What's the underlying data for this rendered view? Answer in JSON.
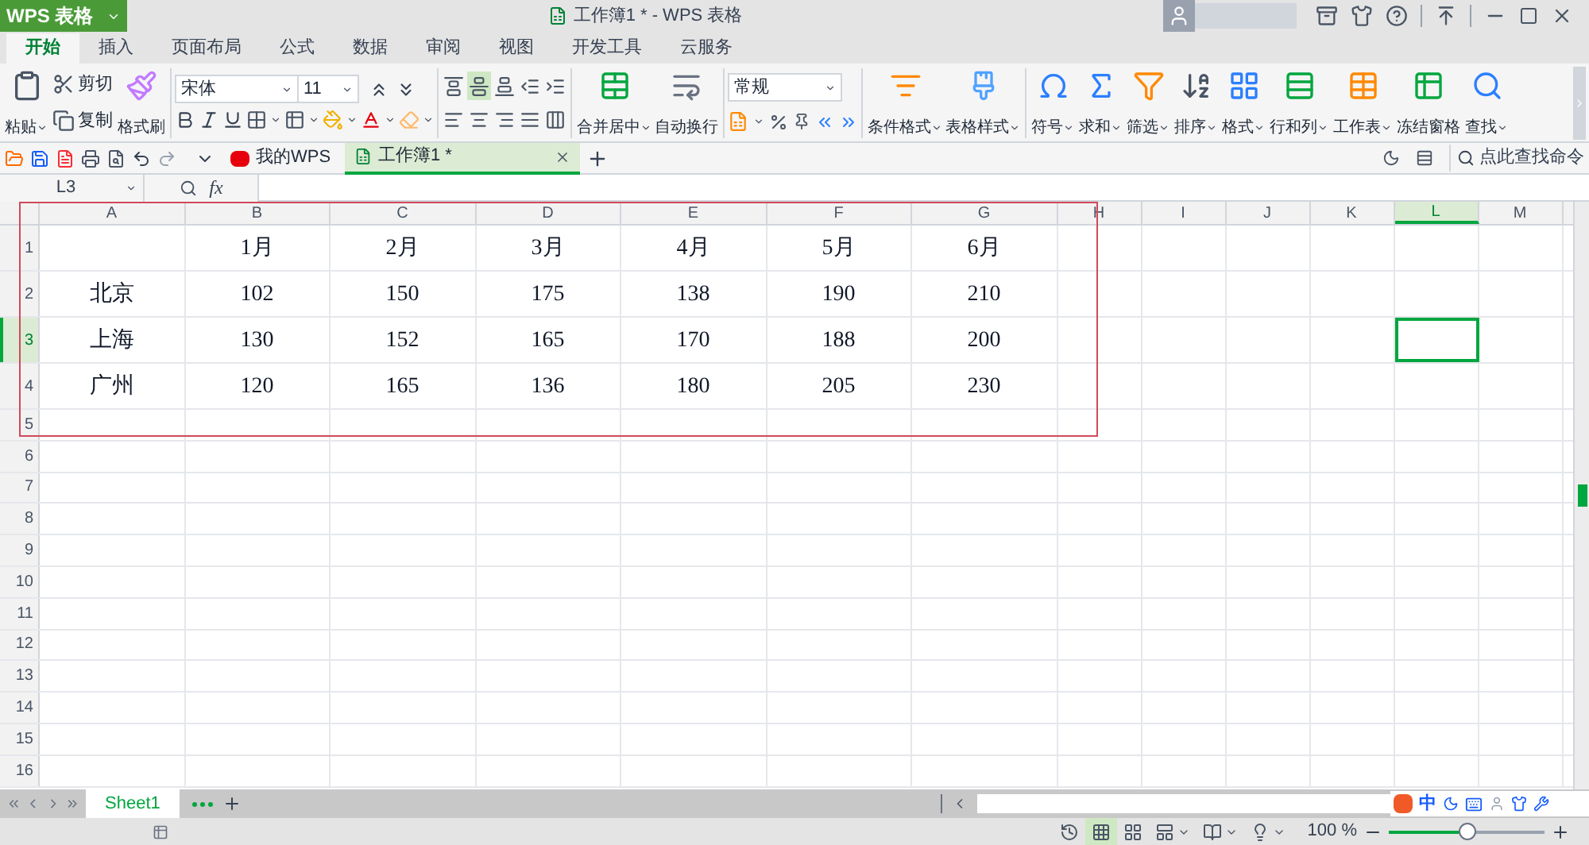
{
  "app_menu": {
    "label": "WPS 表格"
  },
  "window": {
    "title": "工作簿1 * - WPS 表格"
  },
  "ribbon_tabs": [
    {
      "label": "开始",
      "selected": true
    },
    {
      "label": "插入",
      "selected": false
    },
    {
      "label": "页面布局",
      "selected": false
    },
    {
      "label": "公式",
      "selected": false
    },
    {
      "label": "数据",
      "selected": false
    },
    {
      "label": "审阅",
      "selected": false
    },
    {
      "label": "视图",
      "selected": false
    },
    {
      "label": "开发工具",
      "selected": false
    },
    {
      "label": "云服务",
      "selected": false
    }
  ],
  "clipboard": {
    "paste": "粘贴",
    "cut": "剪切",
    "copy": "复制",
    "format_painter": "格式刷"
  },
  "font": {
    "name": "宋体",
    "size": "11"
  },
  "alignment": [
    {
      "kind": "top",
      "selected": false
    },
    {
      "kind": "middle",
      "selected": true
    },
    {
      "kind": "bottom",
      "selected": false
    },
    {
      "kind": "indent-less",
      "selected": false
    },
    {
      "kind": "indent-more",
      "selected": false
    },
    {
      "kind": "left",
      "selected": false
    },
    {
      "kind": "center",
      "selected": false
    },
    {
      "kind": "right",
      "selected": false
    },
    {
      "kind": "justify",
      "selected": false
    },
    {
      "kind": "distributed",
      "selected": false
    }
  ],
  "cell_buttons": [
    {
      "label": "合并居中",
      "menu": true
    },
    {
      "label": "自动换行",
      "menu": false
    }
  ],
  "number_format": "常规",
  "style_buttons": [
    {
      "label": "条件格式",
      "menu": true
    },
    {
      "label": "表格样式",
      "menu": true
    }
  ],
  "tool_buttons": [
    {
      "label": "符号",
      "menu": true
    },
    {
      "label": "求和",
      "menu": true
    },
    {
      "label": "筛选",
      "menu": true
    },
    {
      "label": "排序",
      "menu": true
    },
    {
      "label": "格式",
      "menu": true
    },
    {
      "label": "行和列",
      "menu": true
    },
    {
      "label": "工作表",
      "menu": true
    },
    {
      "label": "冻结窗格",
      "menu": false
    },
    {
      "label": "查找",
      "menu": true
    }
  ],
  "doc_tabs": [
    {
      "label": "我的WPS",
      "selected": false
    },
    {
      "label": "工作簿1 *",
      "selected": true
    }
  ],
  "command_search": {
    "placeholder": "点此查找命令"
  },
  "formula_bar": {
    "name_box": "L3",
    "function_label": "fx"
  },
  "columns": [
    {
      "label": "A",
      "selected": false
    },
    {
      "label": "B",
      "selected": false
    },
    {
      "label": "C",
      "selected": false
    },
    {
      "label": "D",
      "selected": false
    },
    {
      "label": "E",
      "selected": false
    },
    {
      "label": "F",
      "selected": false
    },
    {
      "label": "G",
      "selected": false
    },
    {
      "label": "H",
      "selected": false
    },
    {
      "label": "I",
      "selected": false
    },
    {
      "label": "J",
      "selected": false
    },
    {
      "label": "K",
      "selected": false
    },
    {
      "label": "L",
      "selected": true
    },
    {
      "label": "M",
      "selected": false
    }
  ],
  "rows": [
    {
      "label": "1",
      "selected": false,
      "cells": [
        "",
        "1月",
        "2月",
        "3月",
        "4月",
        "5月",
        "6月"
      ]
    },
    {
      "label": "2",
      "selected": false,
      "cells": [
        "北京",
        "102",
        "150",
        "175",
        "138",
        "190",
        "210"
      ]
    },
    {
      "label": "3",
      "selected": true,
      "cells": [
        "上海",
        "130",
        "152",
        "165",
        "170",
        "188",
        "200"
      ]
    },
    {
      "label": "4",
      "selected": false,
      "cells": [
        "广州",
        "120",
        "165",
        "136",
        "180",
        "205",
        "230"
      ]
    },
    {
      "label": "5",
      "selected": false
    },
    {
      "label": "6",
      "selected": false
    },
    {
      "label": "7",
      "selected": false
    },
    {
      "label": "8",
      "selected": false
    },
    {
      "label": "9",
      "selected": false
    },
    {
      "label": "10",
      "selected": false
    },
    {
      "label": "11",
      "selected": false
    },
    {
      "label": "12",
      "selected": false
    },
    {
      "label": "13",
      "selected": false
    },
    {
      "label": "14",
      "selected": false
    },
    {
      "label": "15",
      "selected": false
    },
    {
      "label": "16",
      "selected": false
    }
  ],
  "sheet_tabs": [
    {
      "label": "Sheet1",
      "selected": true
    }
  ],
  "ime_toolbar": {
    "mode": "中"
  },
  "status_bar": {
    "views": [
      {
        "kind": "normal",
        "selected": true
      },
      {
        "kind": "page-break",
        "selected": false
      },
      {
        "kind": "page-layout",
        "selected": false
      },
      {
        "kind": "reading",
        "selected": false
      },
      {
        "kind": "eye-care",
        "selected": false
      }
    ],
    "zoom": "100 %",
    "level": 0.5
  }
}
